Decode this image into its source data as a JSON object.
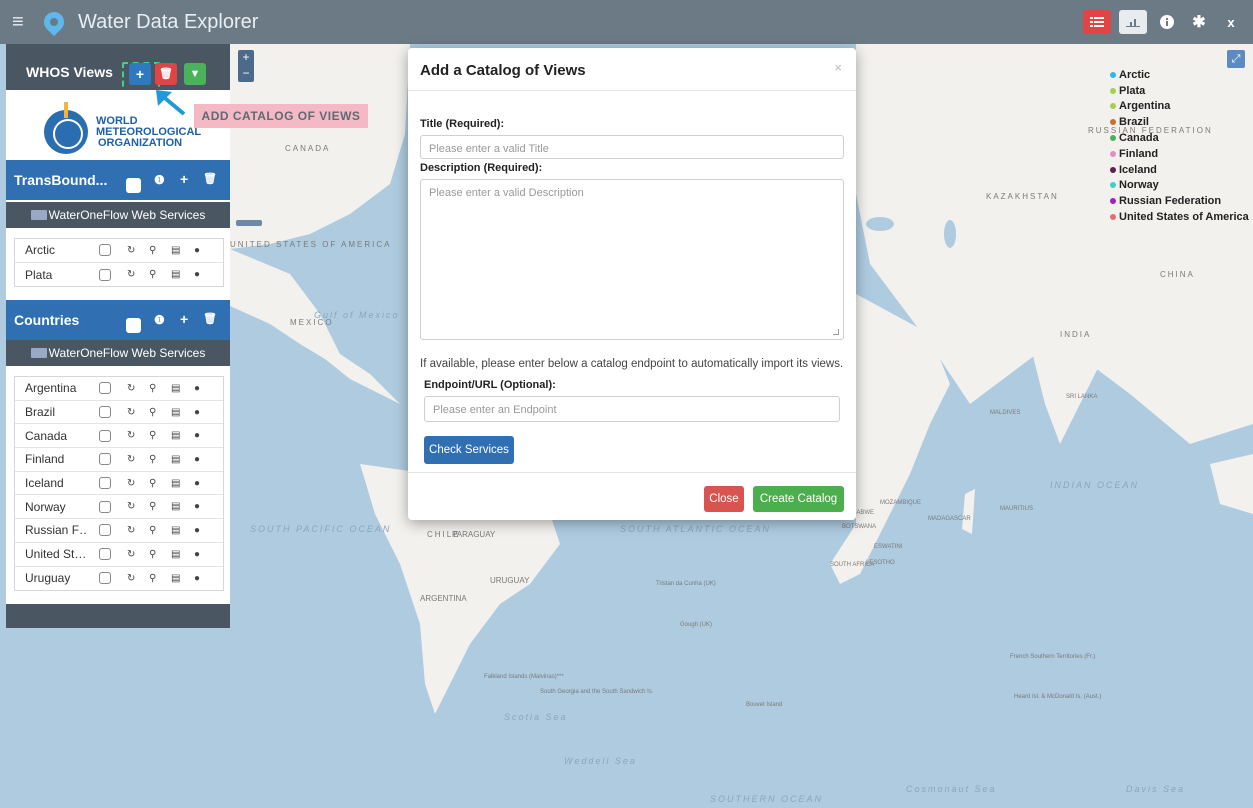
{
  "app": {
    "title": "Water Data Explorer"
  },
  "topbar": {
    "buttons": [
      "list-icon",
      "chart-icon",
      "info-icon",
      "gear-icon",
      "close-icon"
    ],
    "close_label": "x"
  },
  "map": {
    "labels": [
      "CANADA",
      "UNITED STATES OF AMERICA",
      "MEXICO",
      "Gulf of Mexico",
      "SOUTH PACIFIC OCEAN",
      "SOUTH ATLANTIC OCEAN",
      "CHILE",
      "PARAGUAY",
      "URUGUAY",
      "ARGENTINA",
      "KAZAKHSTAN",
      "CHINA",
      "INDIA",
      "INDIAN OCEAN",
      "SOUTHERN OCEAN",
      "Tristan da Cunha (UK)",
      "Gough (UK)",
      "Falkland Islands (Malvinas)***",
      "South Georgia and the South Sandwich Is.",
      "Bouvet Island",
      "French Southern Territories (Fr.)",
      "Heard Isl. & McDonald Is. (Aust.)",
      "MALDIVES",
      "SRI LANKA",
      "MADAGASCAR",
      "MAURITIUS",
      "Weddell Sea",
      "Scotia Sea",
      "Cosmonaut Sea",
      "Davis Sea",
      "RUSSIAN FEDERATION",
      "MOZAMBIQUE",
      "ZIMBABWE",
      "BOTSWANA",
      "SOUTH AFRICA",
      "LESOTHO",
      "ESWATINI"
    ],
    "zoom_in": "+",
    "zoom_out": "−",
    "expand": "⤢"
  },
  "legend": [
    {
      "label": "Arctic",
      "color": "#31b7e8"
    },
    {
      "label": "Plata",
      "color": "#a6cf52"
    },
    {
      "label": "Argentina",
      "color": "#a6cf52"
    },
    {
      "label": "Brazil",
      "color": "#c67030"
    },
    {
      "label": "Canada",
      "color": "#49b25a"
    },
    {
      "label": "Finland",
      "color": "#e090c0"
    },
    {
      "label": "Iceland",
      "color": "#5a2050"
    },
    {
      "label": "Norway",
      "color": "#40d0c0"
    },
    {
      "label": "Russian Federation",
      "color": "#a020c0"
    },
    {
      "label": "United States of America",
      "color": "#e07070"
    }
  ],
  "sidebar": {
    "whos_title": "WHOS Views",
    "add_label": "+",
    "wmo": {
      "line1": "WORLD",
      "line2": "METEOROLOGICAL",
      "line3": "ORGANIZATION"
    },
    "groups": [
      {
        "title": "TransBound...",
        "service": "WaterOneFlow Web Services",
        "items": [
          "Arctic",
          "Plata"
        ]
      },
      {
        "title": "Countries",
        "service": "WaterOneFlow Web Services",
        "items": [
          "Argentina",
          "Brazil",
          "Canada",
          "Finland",
          "Iceland",
          "Norway",
          "Russian F…",
          "United St…",
          "Uruguay"
        ]
      }
    ]
  },
  "annotation": {
    "label": "ADD CATALOG OF VIEWS"
  },
  "modal": {
    "title": "Add a Catalog of Views",
    "close_x": "×",
    "title_label": "Title (Required):",
    "title_placeholder": "Please enter a valid Title",
    "desc_label": "Description (Required):",
    "desc_placeholder": "Please enter a valid Description",
    "help_text": "If available, please enter below a catalog endpoint to automatically import its views.",
    "endpoint_label": "Endpoint/URL (Optional):",
    "endpoint_placeholder": "Please enter an Endpoint",
    "check_button": "Check Services",
    "close_button": "Close",
    "create_button": "Create Catalog"
  }
}
